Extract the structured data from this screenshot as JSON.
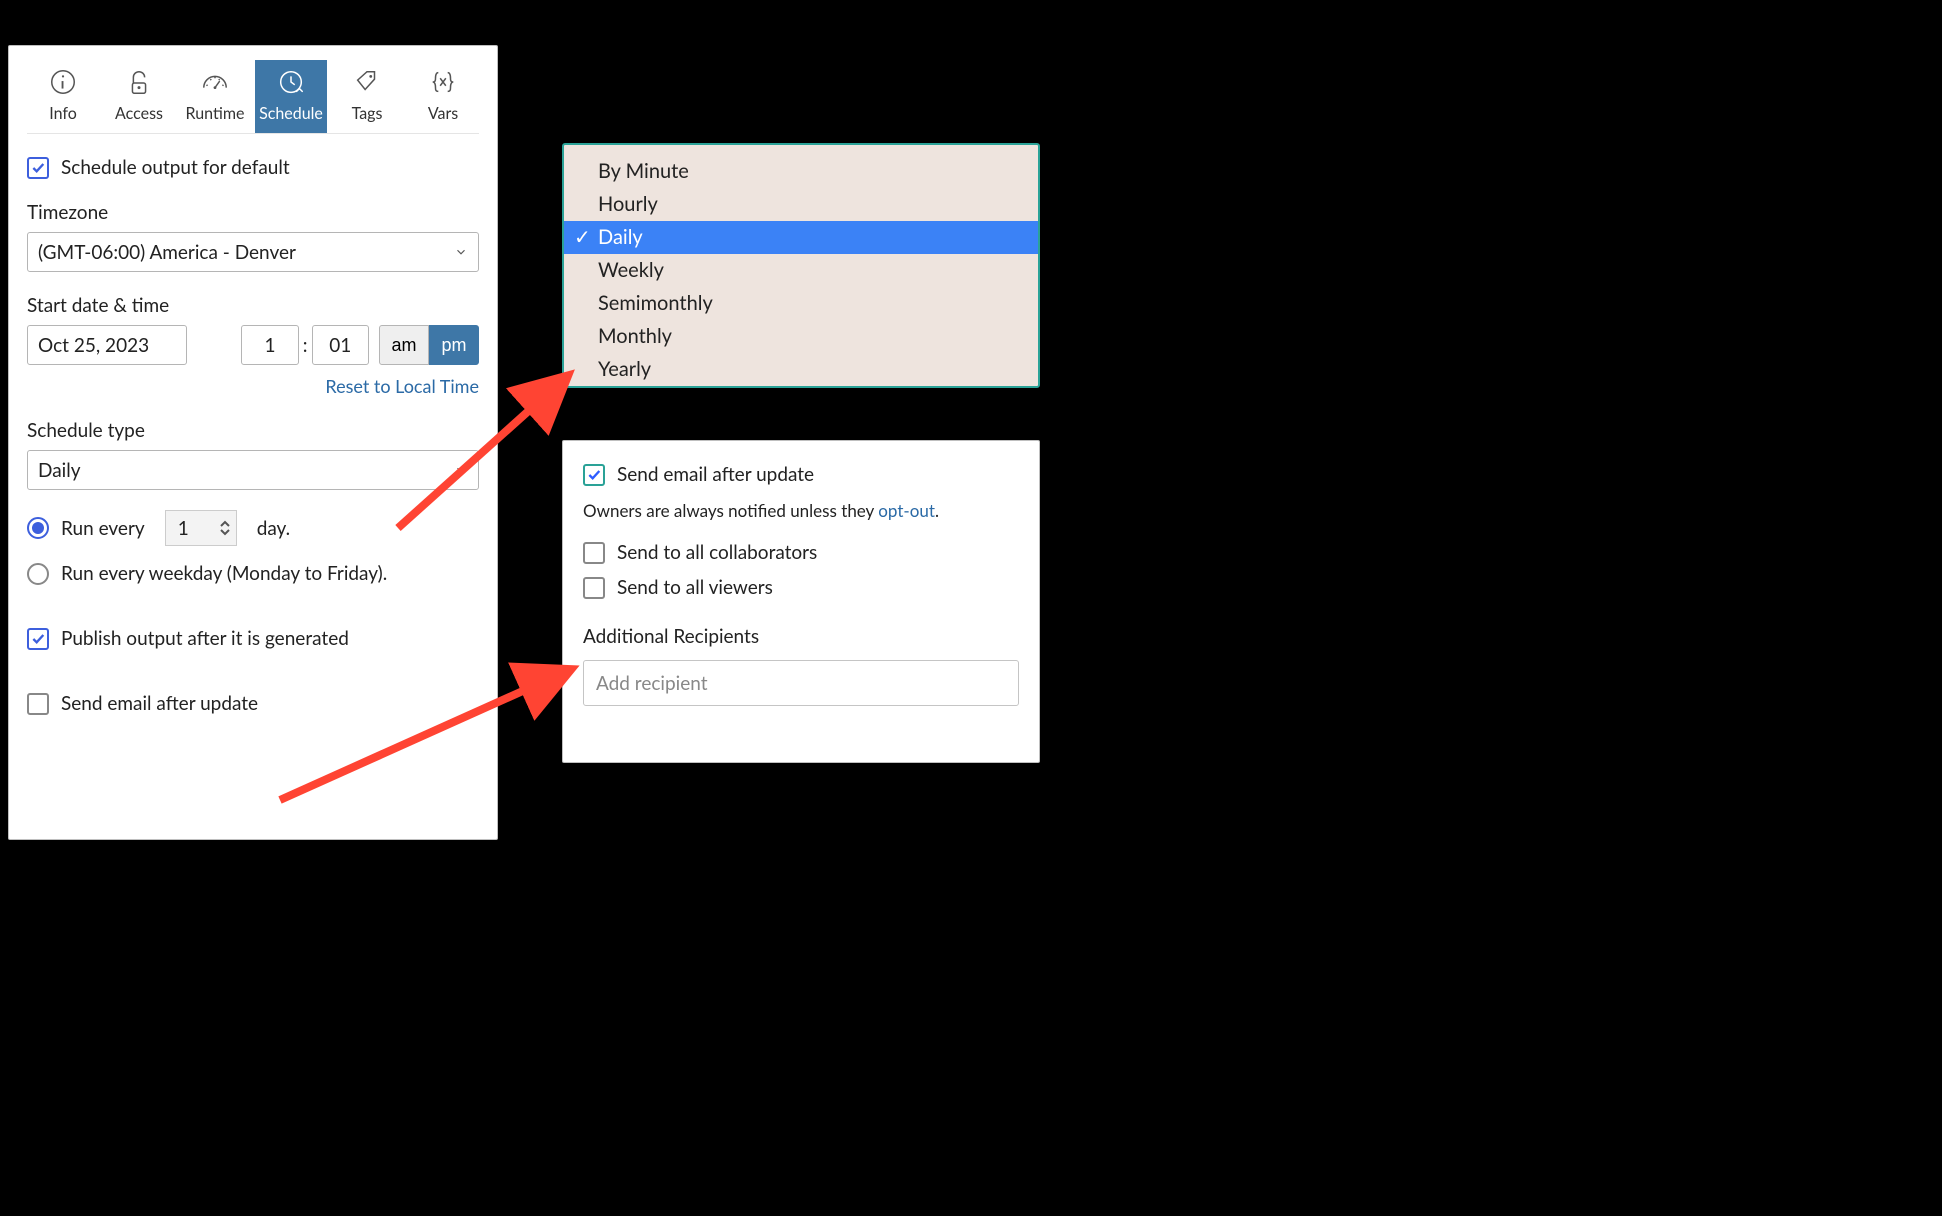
{
  "tabs": [
    {
      "id": "info",
      "label": "Info"
    },
    {
      "id": "access",
      "label": "Access"
    },
    {
      "id": "runtime",
      "label": "Runtime"
    },
    {
      "id": "schedule",
      "label": "Schedule"
    },
    {
      "id": "tags",
      "label": "Tags"
    },
    {
      "id": "vars",
      "label": "Vars"
    }
  ],
  "active_tab": "schedule",
  "schedule": {
    "enable_label": "Schedule output for default",
    "timezone_label": "Timezone",
    "timezone_value": "(GMT-06:00) America - Denver",
    "start_label": "Start date & time",
    "date": "Oct 25, 2023",
    "hour": "1",
    "minute": "01",
    "am": "am",
    "pm": "pm",
    "ampm_selected": "pm",
    "reset_link": "Reset to Local Time",
    "type_label": "Schedule type",
    "type_value": "Daily",
    "run_every_prefix": "Run every",
    "run_every_value": "1",
    "run_every_suffix": "day.",
    "weekday_label": "Run every weekday (Monday to Friday).",
    "publish_label": "Publish output after it is generated",
    "email_label": "Send email after update"
  },
  "dropdown": {
    "items": [
      "By Minute",
      "Hourly",
      "Daily",
      "Weekly",
      "Semimonthly",
      "Monthly",
      "Yearly"
    ],
    "selected": "Daily"
  },
  "email_panel": {
    "header": "Send email after update",
    "note_prefix": "Owners are always notified unless they ",
    "note_link": "opt-out",
    "note_suffix": ".",
    "collab_label": "Send to all collaborators",
    "viewers_label": "Send to all viewers",
    "additional_label": "Additional Recipients",
    "placeholder": "Add recipient"
  }
}
